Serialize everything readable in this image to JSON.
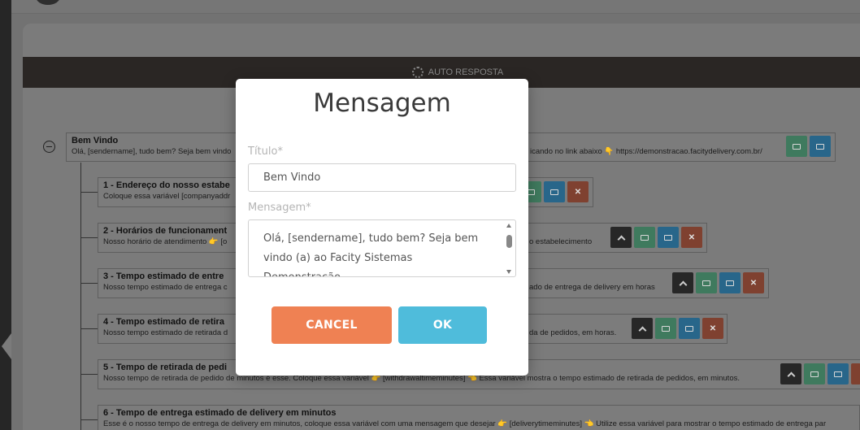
{
  "header": {
    "label": "AUTO RESPOSTA"
  },
  "tree": {
    "root": {
      "title": "Bem Vindo",
      "desc_left": "Olá, [sendername], tudo bem? Seja bem vindo",
      "desc_right": "icando no link abaixo 👇 https://demonstracao.facitydelivery.com.br/"
    },
    "items": [
      {
        "title": "1 - Endereço do nosso estabe",
        "desc_left": "Coloque essa variável [companyaddr",
        "desc_right": ""
      },
      {
        "title": "2 - Horários de funcionament",
        "desc_left": "Nosso horário de atendimento 👉 [o",
        "desc_right": "o estabelecimento"
      },
      {
        "title": "3 - Tempo estimado de entre",
        "desc_left": "Nosso tempo estimado de entrega c",
        "desc_right": "ado de entrega de delivery em horas"
      },
      {
        "title": "4 - Tempo estimado de retira",
        "desc_left": "Nosso tempo estimado de retirada d",
        "desc_right": "da de pedidos, em horas."
      },
      {
        "title": "5 - Tempo de retirada de pedi",
        "desc_left": "Nosso tempo de retirada de pedido de minutos é esse. Coloque essa variável 👉 [withdrawaltimeminutes] 👈 Essa variável mostra o tempo estimado de retirada de pedidos, em minutos.",
        "desc_right": ""
      },
      {
        "title": "6 - Tempo de entrega estimado de delivery em minutos",
        "desc_left": "Esse é o nosso tempo de entrega de delivery em minutos, coloque essa variável com uma mensagem que desejar 👉 [deliverytimeminutes] 👈 Utilize essa variável para mostrar o tempo estimado de entrega par",
        "desc_right": ""
      }
    ]
  },
  "modal": {
    "heading": "Mensagem",
    "title_label": "Título*",
    "title_value": "Bem Vindo",
    "message_label": "Mensagem*",
    "message_value": "Olá, [sendername], tudo bem? Seja bem vindo (a) ao Facity Sistemas Demonstração",
    "cancel_label": "CANCEL",
    "ok_label": "OK"
  },
  "colors": {
    "cancel": "#ef8153",
    "ok": "#4fbcdb"
  }
}
